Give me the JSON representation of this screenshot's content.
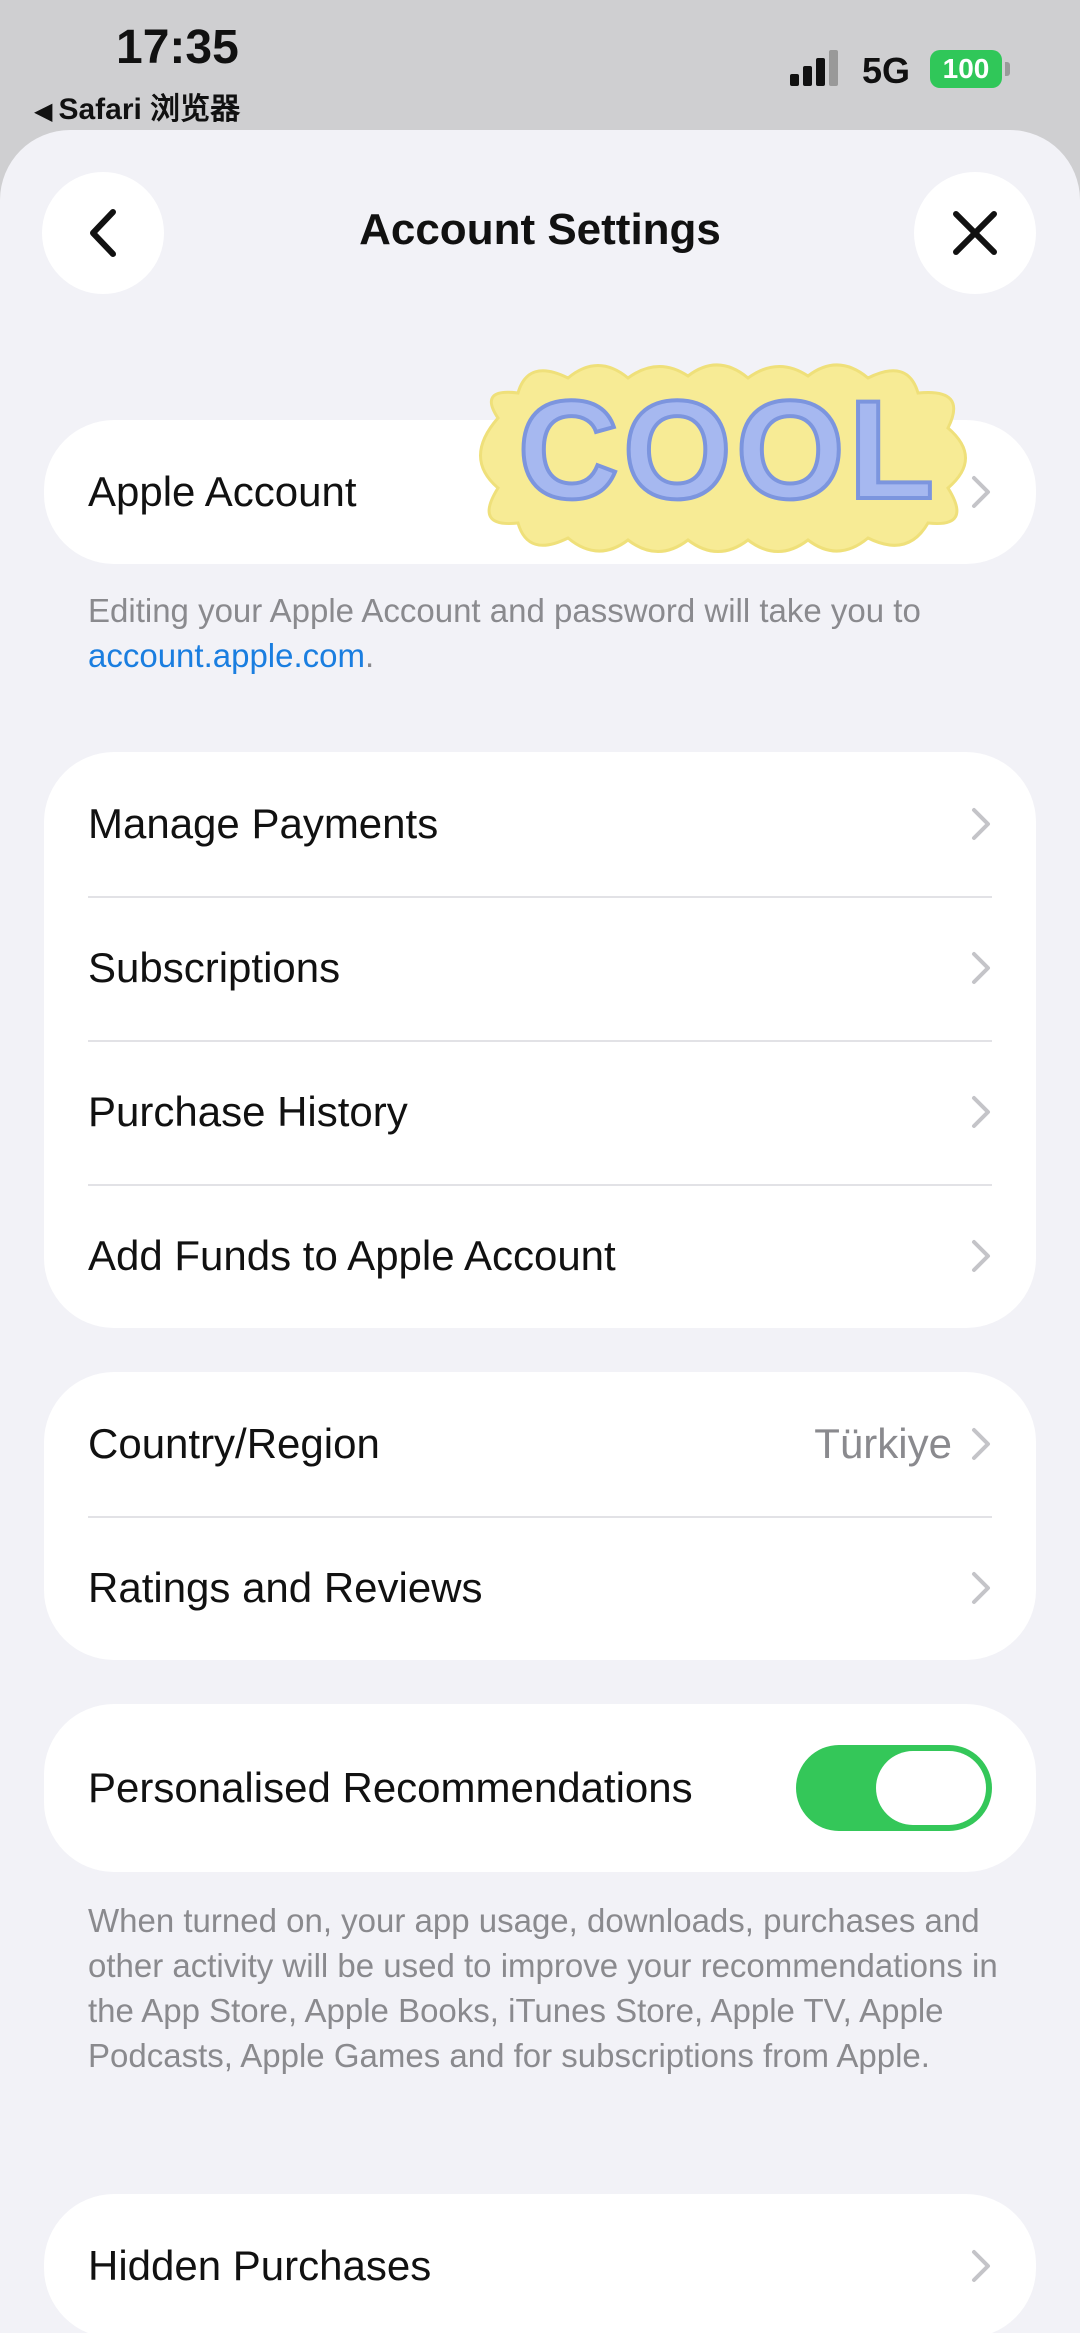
{
  "status": {
    "time": "17:35",
    "back_app": "Safari 浏览器",
    "network": "5G",
    "battery": "100"
  },
  "header": {
    "title": "Account Settings"
  },
  "apple_account": {
    "label": "Apple Account",
    "note_text": "Editing your Apple Account and password will take you to ",
    "note_link": "account.apple.com",
    "note_end": "."
  },
  "payments_group": [
    {
      "label": "Manage Payments"
    },
    {
      "label": "Subscriptions"
    },
    {
      "label": "Purchase History"
    },
    {
      "label": "Add Funds to Apple Account"
    }
  ],
  "region_group": {
    "country_label": "Country/Region",
    "country_value": "Türkiye",
    "ratings_label": "Ratings and Reviews"
  },
  "recommendations": {
    "label": "Personalised Recommendations",
    "enabled": true,
    "note": "When turned on, your app usage, downloads, purchases and other activity will be used to improve your recommendations in the App Store, Apple Books, iTunes Store, Apple TV, Apple Podcasts, Apple Games and for subscriptions from Apple."
  },
  "hidden_purchases": {
    "label": "Hidden Purchases"
  },
  "sticker": {
    "text": "COOL"
  },
  "colors": {
    "accent_link": "#1a7ee0",
    "toggle_on": "#34c759",
    "battery": "#30c759",
    "background": "#f2f2f7"
  }
}
